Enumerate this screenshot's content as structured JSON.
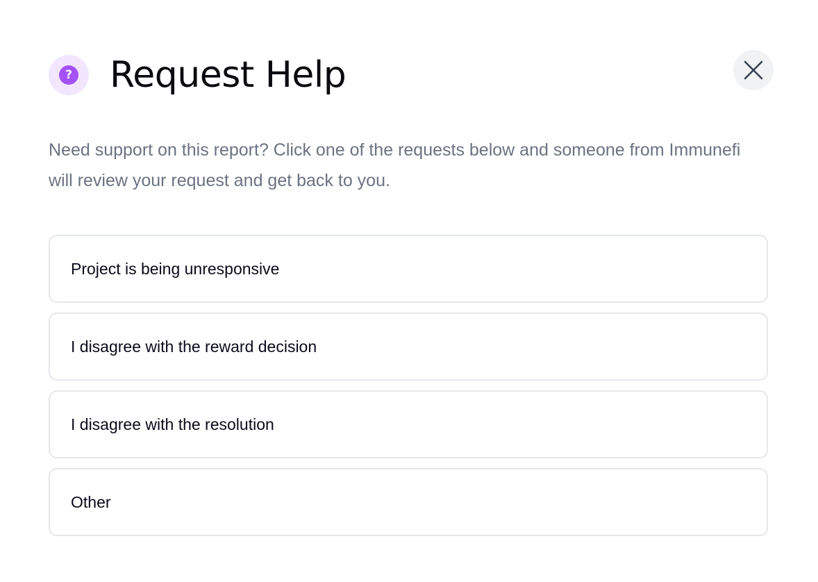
{
  "modal": {
    "title": "Request Help",
    "help_icon_glyph": "?",
    "icons": {
      "header": "question-mark-icon",
      "close": "close-icon"
    },
    "description": "Need support on this report? Click one of the requests below and someone from Immunefi will review your request and get back to you.",
    "options": [
      {
        "label": "Project is being unresponsive"
      },
      {
        "label": "I disagree with the reward decision"
      },
      {
        "label": "I disagree with the resolution"
      },
      {
        "label": "Other"
      }
    ],
    "colors": {
      "accent": "#a452f7",
      "accent_light": "#f2e6fe",
      "text_primary": "#0b0b0f",
      "text_secondary": "#6b7280",
      "border": "#e5e7eb"
    }
  }
}
